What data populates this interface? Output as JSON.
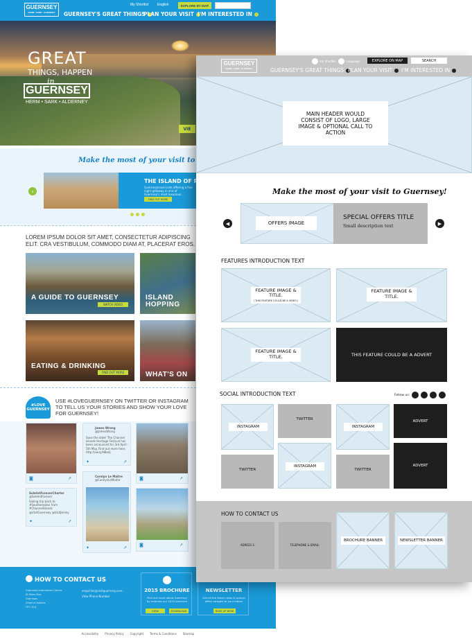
{
  "design": {
    "logo": {
      "name": "GUERNSEY",
      "sub": "HERM • SARK • ALDERNEY"
    },
    "utility": {
      "shortlist": "My Shortlist",
      "language": "English",
      "map": "EXPLORE BY MAP"
    },
    "nav": [
      "GUERNSEY'S GREAT THINGS",
      "PLAN YOUR VISIT",
      "I'M INTERESTED IN"
    ],
    "hero": {
      "line1": "GREAT",
      "line2": "THINGS, HAPPEN",
      "in": "in",
      "name": "GUERNSEY",
      "sub": "HERM • SARK • ALDERNEY",
      "cta": "VIE"
    },
    "script": "Make the most of your visit to Guernsey",
    "offer": {
      "title": "THE ISLAND OF RO",
      "text": "Guernseytravel.com offering a five night getaway in one of Guernsey's most luxurious...",
      "button": "FIND OUT MORE"
    },
    "intro": "LOREM IPSUM DOLOR SIT AMET, CONSECTETUR ADIPISCING ELIT. CRA VESTIBULUM, COMMODO DIAM AT, PLACERAT EROS.",
    "tiles": [
      {
        "caption": "A GUIDE TO GUERNSEY",
        "button": "WATCH VIDEO"
      },
      {
        "caption": "ISLAND HOPPING",
        "button": ""
      },
      {
        "caption": "EATING & DRINKING",
        "button": "FIND OUT MORE"
      },
      {
        "caption": "WHAT'S ON",
        "button": ""
      }
    ],
    "social": {
      "badge": "#LOVE GUERNSEY",
      "text": "USE #LOVEGUERNSEY ON TWITTER OR INSTAGRAM TO TELL US YOUR STORIES AND SHOW YOUR LOVE FOR GUERNSEY!"
    },
    "tweets": [
      {
        "name": "James Wrong",
        "handle": "@JamesWrong",
        "text": "Save the date! The Channel Islands Heritage Festival has been announced for 3rd April - 5th May. Find out more here: http://ow.ly/HBedj"
      },
      {
        "name": "SoletntForeverCharter",
        "handle": "@SoletntForever",
        "text": "Sailing trip back to #Southampton from #ChannelIslands @VisitGuernsey @VisitJersey"
      },
      {
        "name": "Carolyn Le Maitre",
        "handle": "@CarolynLeMaitre",
        "text": ""
      }
    ],
    "footer": {
      "contact_title": "HOW TO CONTACT US",
      "address": [
        "Guernsey Information Centre",
        "St Peter Port",
        "Guernsey",
        "Channel Islands",
        "GY1 2LQ"
      ],
      "email": "enquiries@visitguernsey.com",
      "phone": "View Phone Number",
      "brochure": {
        "title": "2015 BROCHURE",
        "text": "Find out more about Guernsey by ordering our 2015 brochure",
        "view": "VIEW",
        "download": "DOWNLOAD"
      },
      "newsletter": {
        "title": "NEWSLETTER",
        "text": "Get all the latest news & special offers straight to your inbox!",
        "button": "SIGN UP NOW"
      },
      "links": [
        "Accessibility",
        "Privacy Policy",
        "Copyright",
        "Terms & Conditions",
        "Sitemap"
      ]
    }
  },
  "wireframe": {
    "logo": {
      "name": "GUERNSEY",
      "sub": "HERM • SARK • ALDERNEY"
    },
    "utility": {
      "shortlist": "My Shortlist",
      "language": "Language",
      "map": "EXPLORE ON MAP",
      "search": "SEARCH"
    },
    "nav": [
      "GUERNSEY'S GREAT THINGS",
      "PLAN YOUR VISIT",
      "I'M INTERESTED IN"
    ],
    "header_note": "MAIN HEADER WOULD CONSIST OF LOGO, LARGE IMAGE & OPTIONAL CALL TO ACTION",
    "script": "Make the most of your visit to Guernsey!",
    "offers_image": "OFFERS IMAGE",
    "offer_title": "SPECIAL OFFERS TITLE",
    "offer_desc": "Small description text",
    "features_intro": "FEATURES INTRODUCTION TEXT",
    "feature_label": "FEATURE IMAGE & TITLE.",
    "feature_note": "( THIS FEATURE COULD BE A VIDEO )",
    "advert_feature": "THIS FEATURE COULD BE A ADVERT",
    "social_intro": "SOCIAL INTRODUCTION TEXT",
    "follow": "Follow us:",
    "social_cells": [
      "INSTAGRAM",
      "TWITTER",
      "INSTAGRAM",
      "ADVERT",
      "TWITTER",
      "INSTAGRAM",
      "TWITTER",
      "ADVERT"
    ],
    "contact_title": "HOW TO CONTACT US",
    "address": "ADRESS 1:",
    "telephone": "TELEPHONE & EMAIL:",
    "brochure": "BROCHURE BANNER",
    "newsletter": "NEWSLETTER BANNER"
  }
}
